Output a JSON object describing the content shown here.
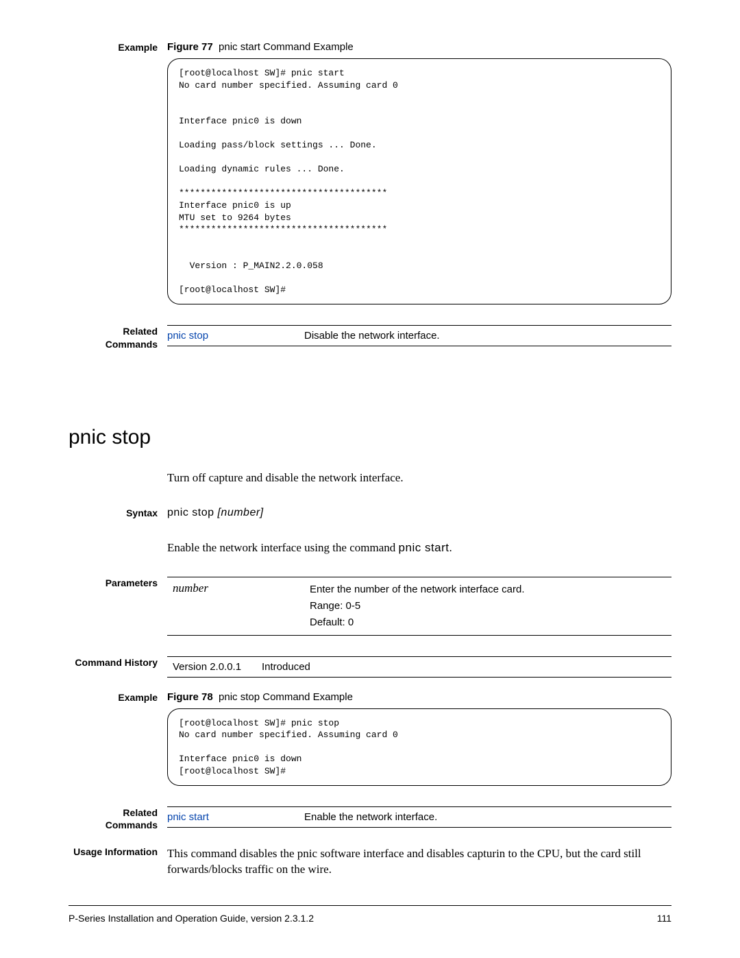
{
  "top": {
    "exampleLabel": "Example",
    "figureBold": "Figure 77",
    "figureTitle": "pnic start Command Example",
    "code": "[root@localhost SW]# pnic start\nNo card number specified. Assuming card 0\n\n\nInterface pnic0 is down\n\nLoading pass/block settings ... Done.\n\nLoading dynamic rules ... Done.\n\n***************************************\nInterface pnic0 is up\nMTU set to 9264 bytes\n***************************************\n\n\n  Version : P_MAIN2.2.0.058\n\n[root@localhost SW]#",
    "relatedLabel": "Related Commands",
    "relatedCmd": "pnic stop",
    "relatedDesc": "Disable the network interface."
  },
  "main": {
    "title": "pnic stop",
    "intro": "Turn off capture and disable the network interface.",
    "syntaxLabel": "Syntax",
    "syntaxCmd": "pnic stop ",
    "syntaxArg": "[number]",
    "enableText1": "Enable the network interface using the command ",
    "enableText2": "pnic start",
    "enableText3": ".",
    "parametersLabel": "Parameters",
    "paramName": "number",
    "paramLine1": "Enter the number of the network interface card.",
    "paramLine2": "Range: 0-5",
    "paramLine3": "Default: 0",
    "historyLabel": "Command History",
    "historyVer": "Version 2.0.0.1",
    "historyDesc": "Introduced",
    "example2Label": "Example",
    "figure2Bold": "Figure 78",
    "figure2Title": "pnic stop Command Example",
    "code2": "[root@localhost SW]# pnic stop\nNo card number specified. Assuming card 0\n\nInterface pnic0 is down\n[root@localhost SW]#",
    "related2Label": "Related Commands",
    "related2Cmd": "pnic start",
    "related2Desc": "Enable the network interface.",
    "usageLabel": "Usage Information",
    "usageText": "This command disables the pnic software interface and disables capturin to the CPU, but the card still forwards/blocks traffic on the wire."
  },
  "footer": {
    "left": "P-Series Installation and Operation Guide, version 2.3.1.2",
    "right": "111"
  }
}
